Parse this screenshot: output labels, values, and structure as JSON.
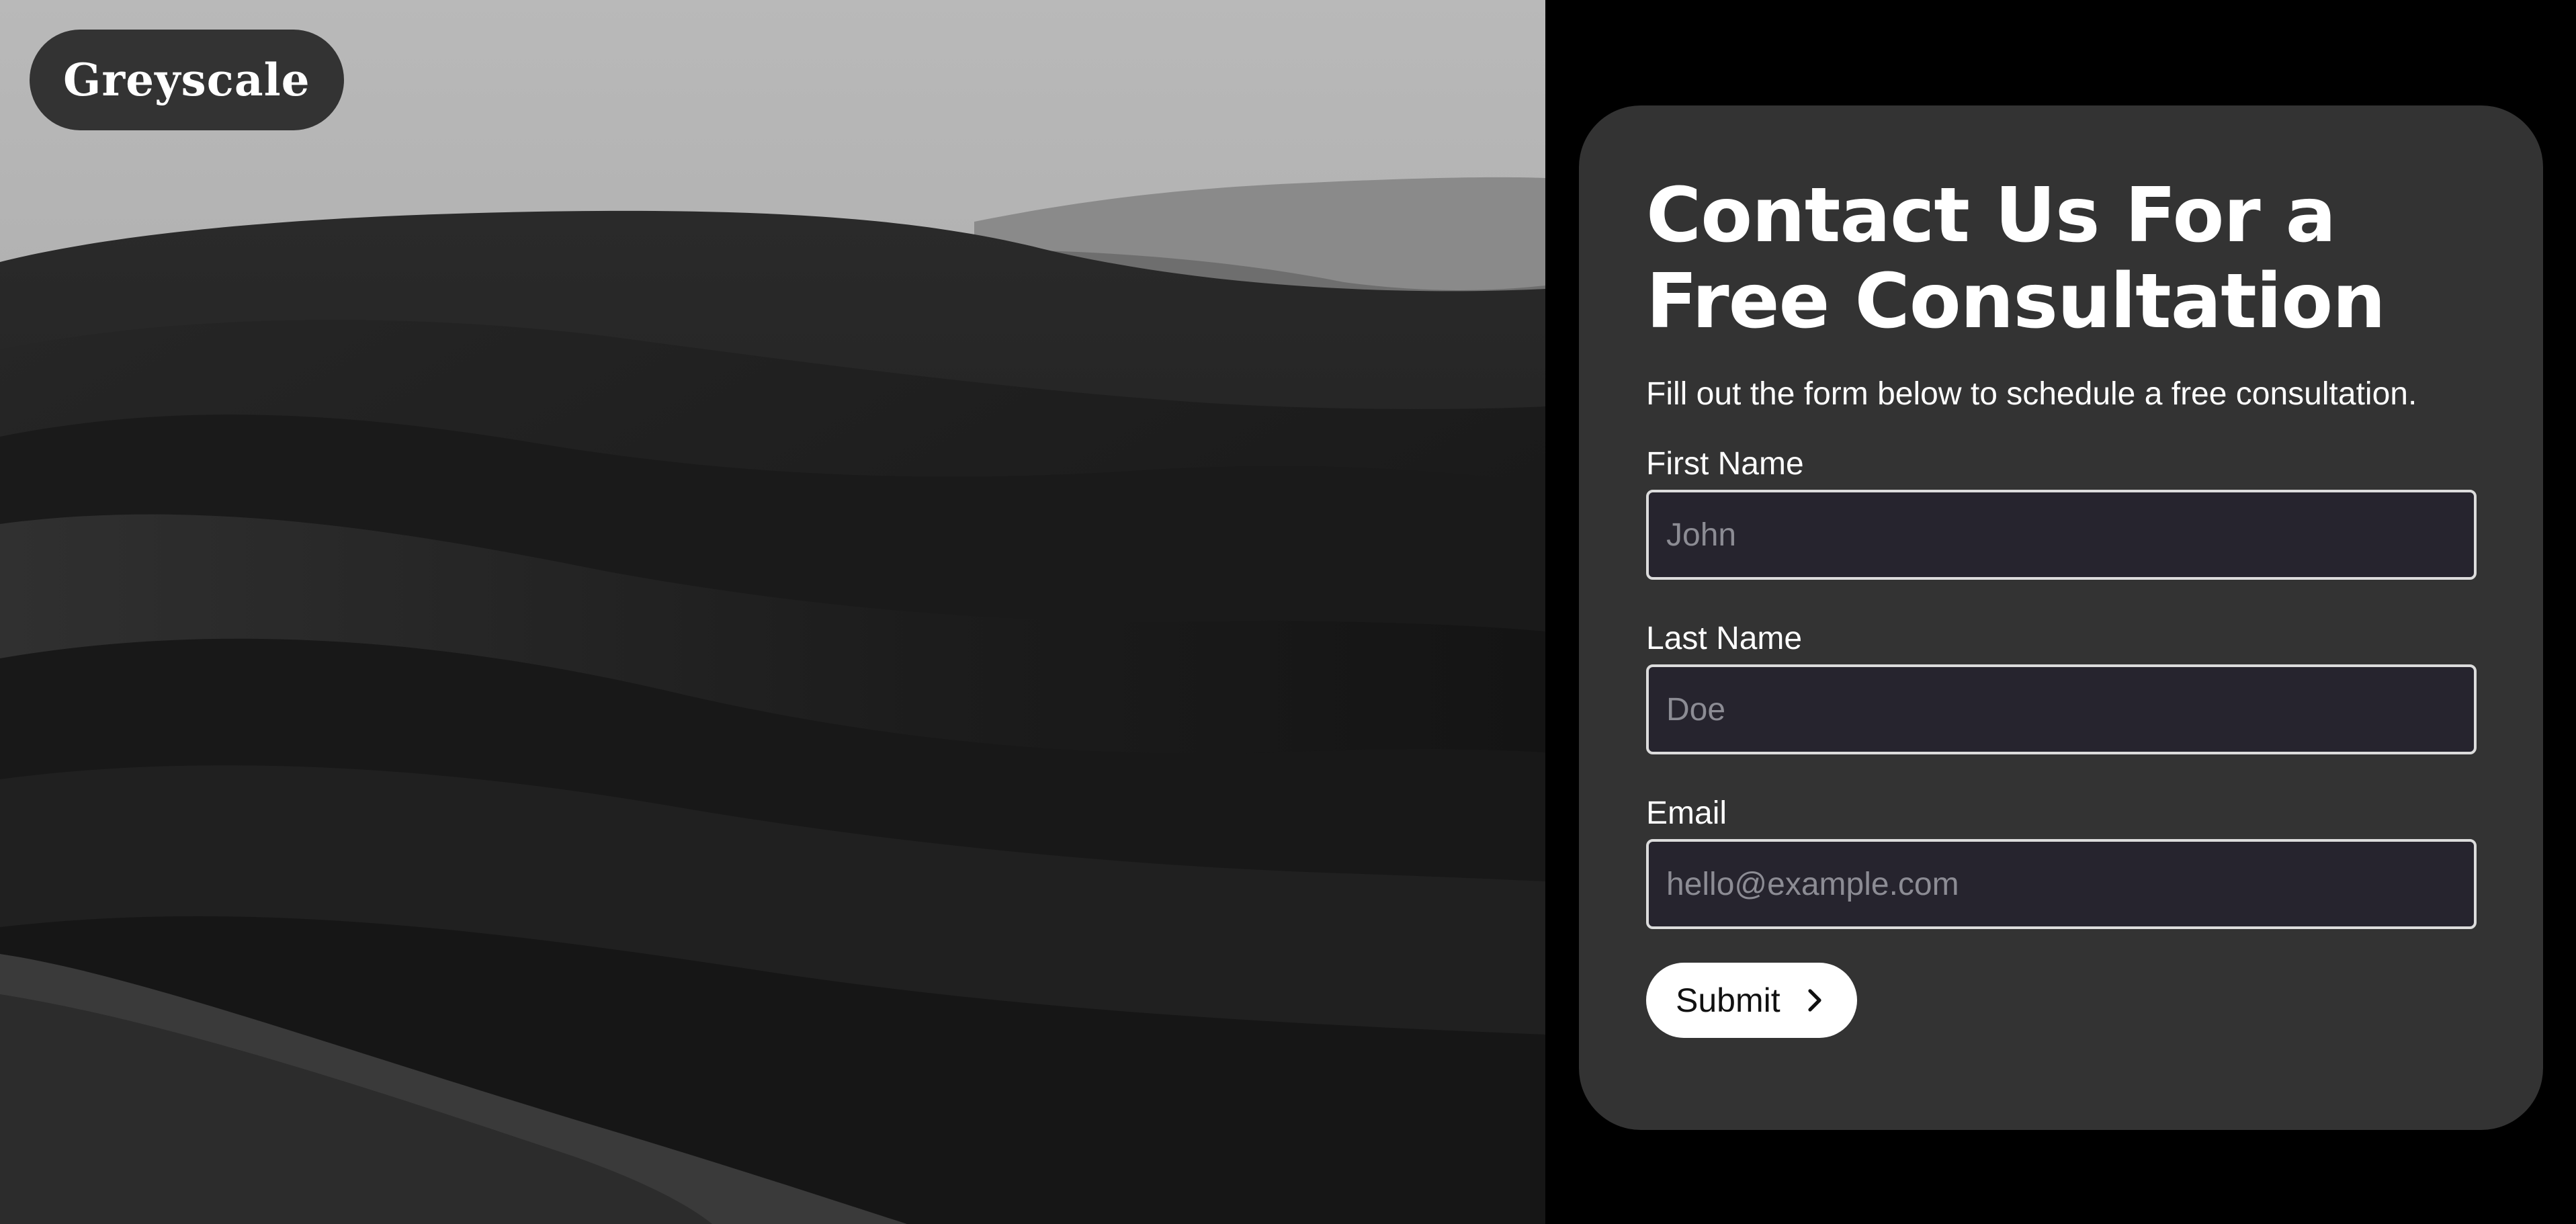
{
  "brand": {
    "name": "Greyscale"
  },
  "contact_form": {
    "title": "Contact Us For a Free Consultation",
    "subtitle": "Fill out the form below to schedule a free consultation.",
    "fields": [
      {
        "label": "First Name",
        "placeholder": "John",
        "value": ""
      },
      {
        "label": "Last Name",
        "placeholder": "Doe",
        "value": ""
      },
      {
        "label": "Email",
        "placeholder": "hello@example.com",
        "value": ""
      }
    ],
    "submit_label": "Submit",
    "submit_icon": "chevron-right-icon"
  },
  "colors": {
    "page_background": "#000000",
    "card_background": "#333333",
    "input_background": "#26242e",
    "input_border": "#dcdcdc",
    "button_background": "#ffffff",
    "text_primary": "#ffffff"
  },
  "hero_image": {
    "subject": "dunes-landscape-image"
  }
}
